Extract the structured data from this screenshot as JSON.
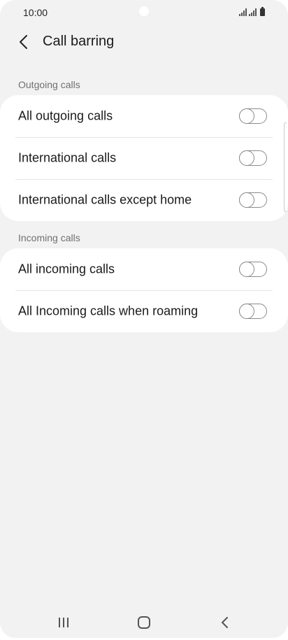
{
  "status_bar": {
    "time": "10:00",
    "icons": [
      "signal-icon",
      "signal-icon",
      "battery-icon"
    ]
  },
  "header": {
    "title": "Call barring",
    "back_icon": "chevron-left-icon"
  },
  "sections": [
    {
      "label": "Outgoing calls",
      "items": [
        {
          "label": "All outgoing calls",
          "enabled": false
        },
        {
          "label": "International calls",
          "enabled": false
        },
        {
          "label": "International calls except home",
          "enabled": false
        }
      ]
    },
    {
      "label": "Incoming calls",
      "items": [
        {
          "label": "All incoming calls",
          "enabled": false
        },
        {
          "label": "All Incoming calls when roaming",
          "enabled": false
        }
      ]
    }
  ],
  "nav_bar": {
    "icons": [
      "recent-apps-icon",
      "home-icon",
      "back-icon"
    ]
  },
  "colors": {
    "background": "#f2f2f2",
    "card": "#ffffff",
    "section_label": "#707070",
    "switch_off": "#8a8a8a"
  }
}
